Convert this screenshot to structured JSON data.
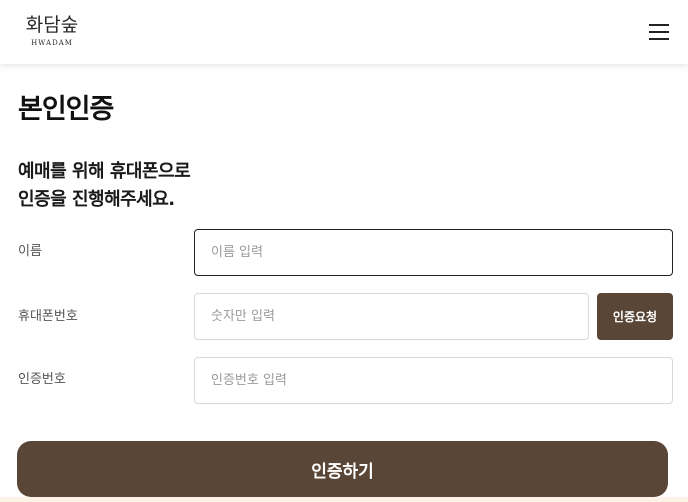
{
  "header": {
    "logo_korean": "화담숲",
    "logo_english": "HWADAM",
    "menu_icon": "hamburger-menu-icon"
  },
  "page": {
    "title": "본인인증",
    "subtitle_line1": "예매를 위해 휴대폰으로",
    "subtitle_line2": "인증을 진행해주세요."
  },
  "form": {
    "name": {
      "label": "이름",
      "placeholder": "이름 입력",
      "value": ""
    },
    "phone": {
      "label": "휴대폰번호",
      "placeholder": "숫자만 입력",
      "value": "",
      "request_button": "인증요청"
    },
    "code": {
      "label": "인증번호",
      "placeholder": "인증번호 입력",
      "value": ""
    },
    "submit_button": "인증하기"
  },
  "colors": {
    "brand": "#5a4637",
    "focus_border": "#222222",
    "input_border": "#d9d9d9"
  }
}
